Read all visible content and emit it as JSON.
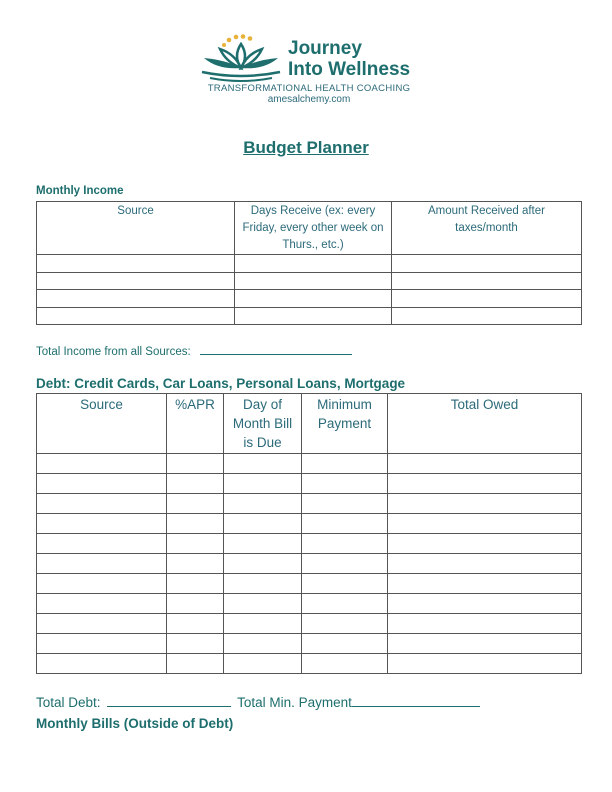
{
  "logo": {
    "brand_line1": "Journey",
    "brand_line2": "Into Wellness",
    "tagline": "TRANSFORMATIONAL HEALTH COACHING",
    "website": "amesalchemy.com",
    "icon": "lotus-icon",
    "colors": {
      "teal": "#1e6e6e",
      "gold": "#e8b23a"
    }
  },
  "title": "Budget Planner",
  "income": {
    "heading": "Monthly Income",
    "columns": [
      "Source",
      "Days Receive (ex:  every Friday, every other week on Thurs., etc.)",
      "Amount Received after taxes/month"
    ],
    "rows": [
      [
        "",
        "",
        ""
      ],
      [
        "",
        "",
        ""
      ],
      [
        "",
        "",
        ""
      ],
      [
        "",
        "",
        ""
      ]
    ],
    "total_label": "Total Income from all Sources:",
    "total_value": ""
  },
  "debt": {
    "heading": "Debt:  Credit Cards, Car Loans, Personal Loans, Mortgage",
    "columns": [
      "Source",
      "%APR",
      "Day of Month Bill is Due",
      "Minimum Payment",
      "Total Owed"
    ],
    "rows": [
      [
        "",
        "",
        "",
        "",
        ""
      ],
      [
        "",
        "",
        "",
        "",
        ""
      ],
      [
        "",
        "",
        "",
        "",
        ""
      ],
      [
        "",
        "",
        "",
        "",
        ""
      ],
      [
        "",
        "",
        "",
        "",
        ""
      ],
      [
        "",
        "",
        "",
        "",
        ""
      ],
      [
        "",
        "",
        "",
        "",
        ""
      ],
      [
        "",
        "",
        "",
        "",
        ""
      ],
      [
        "",
        "",
        "",
        "",
        ""
      ],
      [
        "",
        "",
        "",
        "",
        ""
      ],
      [
        "",
        "",
        "",
        "",
        ""
      ]
    ],
    "total_debt_label": "Total Debt:",
    "total_min_label": "Total Min. Payment"
  },
  "bills": {
    "heading": "Monthly Bills (Outside of Debt)"
  }
}
